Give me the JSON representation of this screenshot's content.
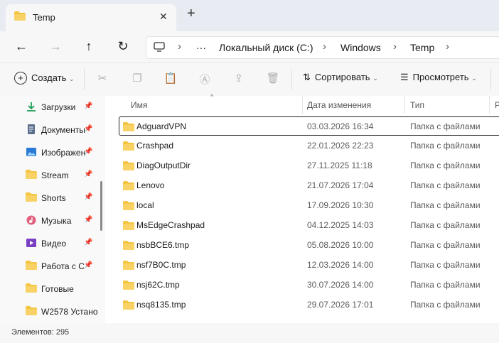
{
  "tab": {
    "title": "Temp"
  },
  "breadcrumb": {
    "items": [
      "Локальный диск (C:)",
      "Windows",
      "Temp"
    ]
  },
  "toolbar": {
    "create": "Создать",
    "sort": "Сортировать",
    "view": "Просмотреть"
  },
  "sidebar": {
    "items": [
      {
        "label": "Загрузки",
        "icon": "download-icon"
      },
      {
        "label": "Документы",
        "icon": "document-icon"
      },
      {
        "label": "Изображения",
        "icon": "image-icon"
      },
      {
        "label": "Stream",
        "icon": "folder-icon"
      },
      {
        "label": "Shorts",
        "icon": "folder-icon"
      },
      {
        "label": "Музыка",
        "icon": "music-icon"
      },
      {
        "label": "Видео",
        "icon": "video-icon"
      },
      {
        "label": "Работа с С",
        "icon": "folder-icon"
      },
      {
        "label": "Готовые",
        "icon": "folder-icon"
      },
      {
        "label": "W2578 Устано",
        "icon": "folder-icon"
      }
    ]
  },
  "columns": {
    "name": "Имя",
    "date": "Дата изменения",
    "type": "Тип",
    "size": "Р"
  },
  "files": [
    {
      "name": "AdguardVPN",
      "date": "03.03.2026 16:34",
      "type": "Папка с файлами"
    },
    {
      "name": "Crashpad",
      "date": "22.01.2026 22:23",
      "type": "Папка с файлами"
    },
    {
      "name": "DiagOutputDir",
      "date": "27.11.2025 11:18",
      "type": "Папка с файлами"
    },
    {
      "name": "Lenovo",
      "date": "21.07.2026 17:04",
      "type": "Папка с файлами"
    },
    {
      "name": "local",
      "date": "17.09.2026 10:30",
      "type": "Папка с файлами"
    },
    {
      "name": "MsEdgeCrashpad",
      "date": "04.12.2025 14:03",
      "type": "Папка с файлами"
    },
    {
      "name": "nsbBCE6.tmp",
      "date": "05.08.2026 10:00",
      "type": "Папка с файлами"
    },
    {
      "name": "nsf7B0C.tmp",
      "date": "12.03.2026 14:00",
      "type": "Папка с файлами"
    },
    {
      "name": "nsj62C.tmp",
      "date": "30.07.2026 14:00",
      "type": "Папка с файлами"
    },
    {
      "name": "nsq8135.tmp",
      "date": "29.07.2026 17:01",
      "type": "Папка с файлами"
    }
  ],
  "status": {
    "count": "Элементов: 295"
  },
  "colors": {
    "folder": "#f4c542",
    "accent": "#0067c0"
  }
}
